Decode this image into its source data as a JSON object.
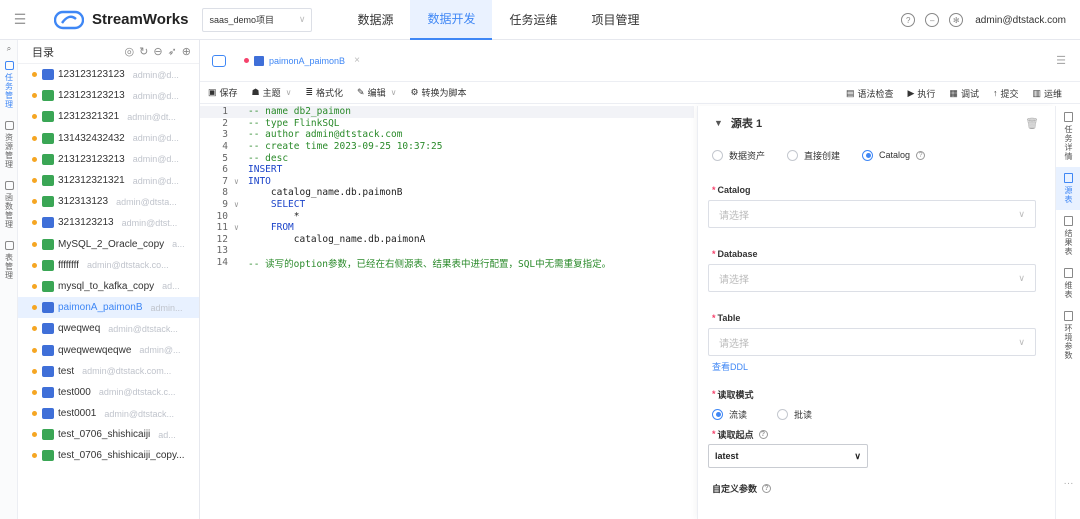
{
  "header": {
    "app_name": "StreamWorks",
    "project": "saas_demo项目",
    "nav": [
      "数据源",
      "数据开发",
      "任务运维",
      "项目管理"
    ],
    "active_nav": "数据开发",
    "user": "admin@dtstack.com"
  },
  "rail": {
    "items": [
      {
        "label": "任务管理",
        "icon": "task-icon"
      },
      {
        "label": "资源管理",
        "icon": "resource-icon"
      },
      {
        "label": "函数管理",
        "icon": "function-icon"
      },
      {
        "label": "表管理",
        "icon": "table-icon"
      }
    ]
  },
  "tree": {
    "title": "目录",
    "items": [
      {
        "name": "123123123123",
        "owner": "admin@d...",
        "type": "sql"
      },
      {
        "name": "123123123213",
        "owner": "admin@d...",
        "type": "flink"
      },
      {
        "name": "12312321321",
        "owner": "admin@dt...",
        "type": "flink"
      },
      {
        "name": "131432432432",
        "owner": "admin@d...",
        "type": "flink"
      },
      {
        "name": "213123123213",
        "owner": "admin@d...",
        "type": "flink"
      },
      {
        "name": "312312321321",
        "owner": "admin@d...",
        "type": "flink"
      },
      {
        "name": "312313123",
        "owner": "admin@dtsta...",
        "type": "flink"
      },
      {
        "name": "3213123213",
        "owner": "admin@dtst...",
        "type": "sql"
      },
      {
        "name": "MySQL_2_Oracle_copy",
        "owner": "a...",
        "type": "flink"
      },
      {
        "name": "ffffffff",
        "owner": "admin@dtstack.co...",
        "type": "flink"
      },
      {
        "name": "mysql_to_kafka_copy",
        "owner": "ad...",
        "type": "flink"
      },
      {
        "name": "paimonA_paimonB",
        "owner": "admin...",
        "type": "sql"
      },
      {
        "name": "qweqweq",
        "owner": "admin@dtstack...",
        "type": "sql"
      },
      {
        "name": "qweqwewqeqwe",
        "owner": "admin@...",
        "type": "sql"
      },
      {
        "name": "test",
        "owner": "admin@dtstack.com...",
        "type": "sql"
      },
      {
        "name": "test000",
        "owner": "admin@dtstack.c...",
        "type": "sql"
      },
      {
        "name": "test0001",
        "owner": "admin@dtstack...",
        "type": "sql"
      },
      {
        "name": "test_0706_shishicaiji",
        "owner": "ad...",
        "type": "flink"
      },
      {
        "name": "test_0706_shishicaiji_copy...",
        "owner": "",
        "type": "flink"
      }
    ],
    "selected": "paimonA_paimonB"
  },
  "tab": {
    "label": "paimonA_paimonB"
  },
  "toolbar": {
    "left": [
      "保存",
      "主题",
      "格式化",
      "编辑",
      "转换为脚本"
    ],
    "right": [
      "语法检查",
      "执行",
      "调试",
      "提交",
      "运维"
    ]
  },
  "code": [
    {
      "n": "1",
      "fold": "",
      "text": "-- name db2_paimon",
      "cls": "cm"
    },
    {
      "n": "2",
      "fold": "",
      "text": "-- type FlinkSQL",
      "cls": "cm"
    },
    {
      "n": "3",
      "fold": "",
      "text": "-- author admin@dtstack.com",
      "cls": "cm"
    },
    {
      "n": "4",
      "fold": "",
      "text": "-- create time 2023-09-25 10:37:25",
      "cls": "cm"
    },
    {
      "n": "5",
      "fold": "",
      "text": "-- desc",
      "cls": "cm"
    },
    {
      "n": "6",
      "fold": "",
      "text": "INSERT",
      "cls": "kw"
    },
    {
      "n": "7",
      "fold": "∨",
      "text": "INTO",
      "cls": "kw"
    },
    {
      "n": "8",
      "fold": "",
      "text": "    catalog_name.db.paimonB",
      "cls": "id"
    },
    {
      "n": "9",
      "fold": "∨",
      "text": "    SELECT",
      "cls": "kw"
    },
    {
      "n": "10",
      "fold": "",
      "text": "        *",
      "cls": "id"
    },
    {
      "n": "11",
      "fold": "∨",
      "text": "    FROM",
      "cls": "kw"
    },
    {
      "n": "12",
      "fold": "",
      "text": "        catalog_name.db.paimonA",
      "cls": "id"
    },
    {
      "n": "13",
      "fold": "",
      "text": "",
      "cls": "id"
    },
    {
      "n": "14",
      "fold": "",
      "text": "-- 读写的option参数，已经在右侧源表、结果表中进行配置，SQL中无需重复指定。",
      "cls": "cm"
    }
  ],
  "config": {
    "title": "源表 1",
    "source_options": [
      "数据资产",
      "直接创建",
      "Catalog"
    ],
    "source_selected": "Catalog",
    "catalog_label": "Catalog",
    "catalog_placeholder": "请选择",
    "database_label": "Database",
    "database_placeholder": "请选择",
    "table_label": "Table",
    "table_placeholder": "请选择",
    "view_ddl": "查看DDL",
    "read_mode_label": "读取模式",
    "read_modes": [
      "流读",
      "批读"
    ],
    "read_mode_selected": "流读",
    "start_label": "读取起点",
    "start_value": "latest",
    "custom_params_label": "自定义参数"
  },
  "right_tabs": [
    "任务详情",
    "源表",
    "结果表",
    "维表",
    "环境参数"
  ],
  "right_tab_active": "源表",
  "colors": {
    "accent": "#3f87f5",
    "sql_badge": "#3f6fd8",
    "flink_badge": "#3aa655",
    "dot": "#f5a623"
  }
}
